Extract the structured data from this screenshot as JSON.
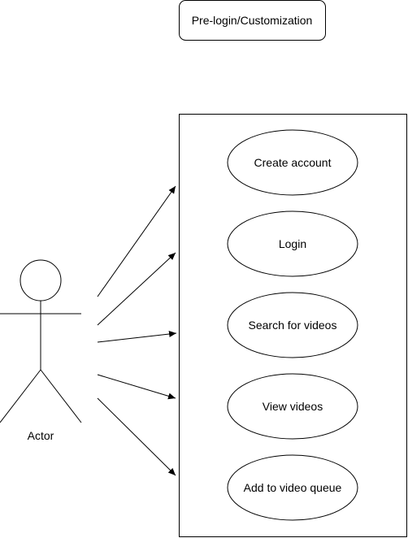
{
  "title": "Pre-login/Customization",
  "actor": {
    "label": "Actor"
  },
  "use_cases": [
    {
      "label": "Create account"
    },
    {
      "label": "Login"
    },
    {
      "label": "Search for videos"
    },
    {
      "label": "View videos"
    },
    {
      "label": "Add to video queue"
    }
  ],
  "colors": {
    "stroke": "#000000",
    "fill": "#ffffff"
  }
}
